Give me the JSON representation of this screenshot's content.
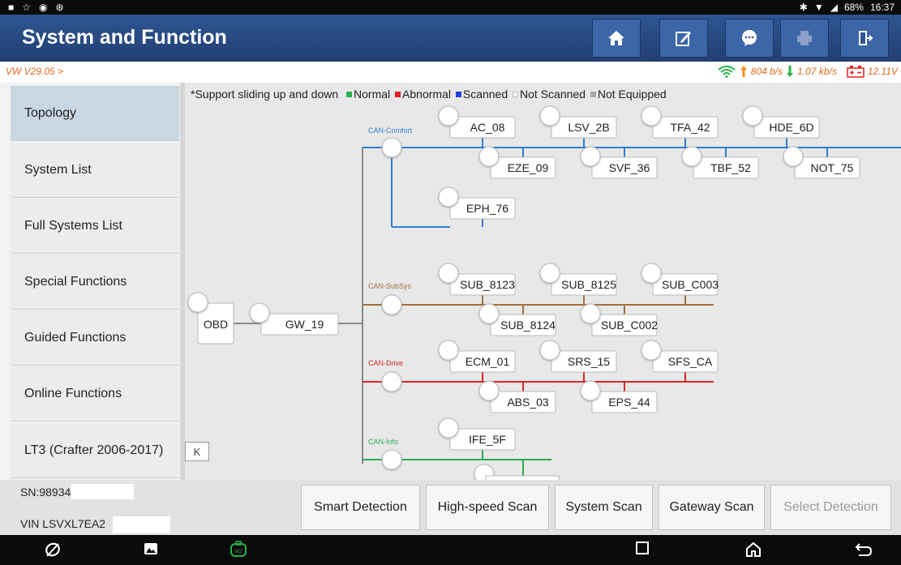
{
  "status_bar": {
    "battery": "68%",
    "time": "16:37",
    "bt": "✱",
    "wifi": "▼",
    "signal": "◢",
    "left_icons": [
      "■",
      "☆",
      "◉",
      "⊛"
    ]
  },
  "header": {
    "title": "System and Function",
    "toolbar_icons": [
      "home-icon",
      "edit-icon",
      "chat-icon",
      "print-icon",
      "exit-icon"
    ]
  },
  "info": {
    "version": "VW V29.05 >",
    "upload": "804 b/s",
    "download": "1.07 kb/s",
    "voltage": "12.11V"
  },
  "sidebar": {
    "items": [
      {
        "label": "Topology"
      },
      {
        "label": "System List"
      },
      {
        "label": "Full Systems List"
      },
      {
        "label": "Special Functions"
      },
      {
        "label": "Guided Functions"
      },
      {
        "label": "Online Functions"
      },
      {
        "label": "LT3 (Crafter 2006-2017)"
      }
    ]
  },
  "topology": {
    "legend": {
      "prefix": "*Support sliding up and down",
      "items": [
        {
          "label": "Normal",
          "color": "#22b14c"
        },
        {
          "label": "Abnormal",
          "color": "#e02020"
        },
        {
          "label": "Scanned",
          "color": "#1f3fdd"
        },
        {
          "label": "Not Scanned",
          "color": "#ffffff"
        },
        {
          "label": "Not Equipped",
          "color": "#a8a8a8"
        }
      ]
    },
    "root_nodes": {
      "obd": "OBD",
      "gateway": "GW_19"
    },
    "buses": [
      {
        "name": "CAN-Comfort",
        "color": "#2d7fd0",
        "top": [
          "AC_08",
          "LSV_2B",
          "TFA_42",
          "HDE_6D"
        ],
        "bottom": [
          "EZE_09",
          "SVF_36",
          "TBF_52",
          "NOT_75"
        ],
        "extra": [
          "EPH_76"
        ]
      },
      {
        "name": "CAN-SubSys",
        "color": "#a0703e",
        "top": [
          "SUB_8123",
          "SUB_8125",
          "SUB_C003"
        ],
        "bottom": [
          "SUB_8124",
          "SUB_C002"
        ],
        "extra": []
      },
      {
        "name": "CAN-Drive",
        "color": "#d92727",
        "top": [
          "ECM_01",
          "SRS_15",
          "SFS_CA"
        ],
        "bottom": [
          "ABS_03",
          "EPS_44"
        ],
        "extra": []
      },
      {
        "name": "CAN-Info",
        "color": "#2fa84f",
        "top": [
          "IFE_5F"
        ],
        "bottom": [],
        "extra": []
      }
    ],
    "collapse_label": "K"
  },
  "footer": {
    "sn": "SN:98934",
    "vin": "VIN LSVXL7EA2",
    "buttons": [
      {
        "label": "Smart Detection"
      },
      {
        "label": "High-speed Scan"
      },
      {
        "label": "System Scan"
      },
      {
        "label": "Gateway Scan"
      },
      {
        "label": "Select Detection"
      }
    ]
  },
  "navbar": {
    "icons": [
      "browser-icon",
      "gallery-icon",
      "vci-icon",
      "recents-icon",
      "home-icon",
      "back-icon"
    ]
  }
}
